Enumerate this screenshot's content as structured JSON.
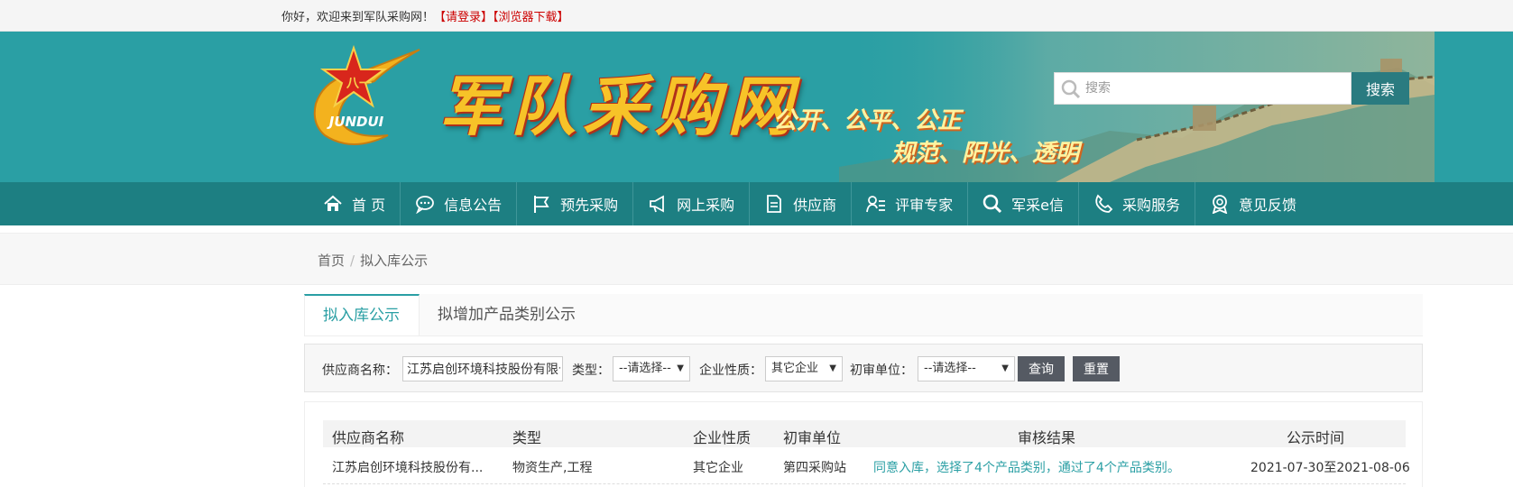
{
  "topbar": {
    "greeting": "你好，欢迎来到军队采购网！",
    "login_link": "【请登录】",
    "browser_link": "【浏览器下载】"
  },
  "banner": {
    "logo_text": "JUNDUI",
    "site_title": "军队采购网",
    "slogan_line1": "公开、公平、公正",
    "slogan_line2": "规范、阳光、透明",
    "search_placeholder": "搜索",
    "search_button": "搜索"
  },
  "nav": {
    "items": [
      {
        "label": "首 页",
        "icon": "home-icon"
      },
      {
        "label": "信息公告",
        "icon": "chat-icon"
      },
      {
        "label": "预先采购",
        "icon": "flag-icon"
      },
      {
        "label": "网上采购",
        "icon": "megaphone-icon"
      },
      {
        "label": "供应商",
        "icon": "document-icon"
      },
      {
        "label": "评审专家",
        "icon": "user-list-icon"
      },
      {
        "label": "军采e信",
        "icon": "search-icon"
      },
      {
        "label": "采购服务",
        "icon": "phone-icon"
      },
      {
        "label": "意见反馈",
        "icon": "badge-icon"
      }
    ]
  },
  "breadcrumb": {
    "home": "首页",
    "separator": "/",
    "current": "拟入库公示"
  },
  "tabs": [
    {
      "label": "拟入库公示",
      "active": true
    },
    {
      "label": "拟增加产品类别公示",
      "active": false
    }
  ],
  "filter": {
    "supplier_label": "供应商名称：",
    "supplier_value": "江苏启创环境科技股份有限公司",
    "type_label": "类型：",
    "type_value": "--请选择--",
    "nature_label": "企业性质：",
    "nature_value": "其它企业",
    "unit_label": "初审单位：",
    "unit_value": "--请选择--",
    "query_button": "查询",
    "reset_button": "重置"
  },
  "table": {
    "headers": [
      "供应商名称",
      "类型",
      "企业性质",
      "初审单位",
      "审核结果",
      "公示时间"
    ],
    "rows": [
      [
        "江苏启创环境科技股份有...",
        "物资生产,工程",
        "其它企业",
        "第四采购站",
        "同意入库，选择了4个产品类别，通过了4个产品类别。",
        "2021-07-30至2021-08-06"
      ]
    ]
  },
  "colors": {
    "banner": "#2a9fa4",
    "nav": "#1d7f82",
    "accent": "#2a9fa4",
    "link_red": "#cc0000"
  }
}
